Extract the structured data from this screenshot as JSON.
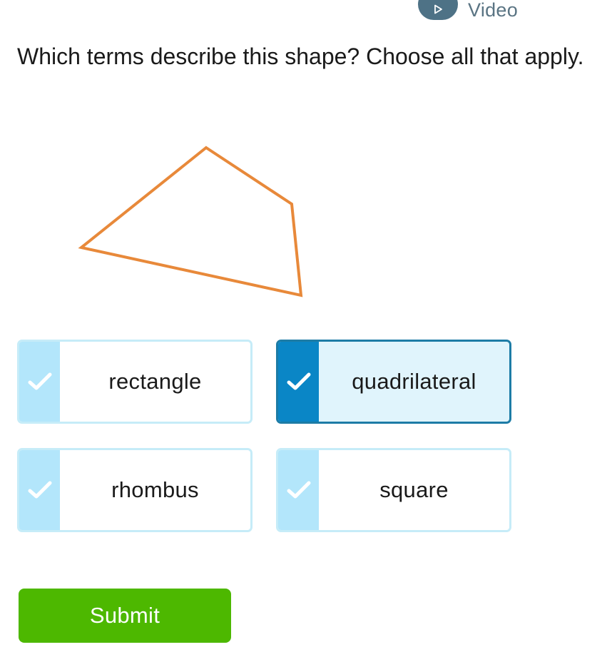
{
  "header": {
    "video_label": "Video"
  },
  "question": {
    "text": "Which terms describe this shape? Choose all that apply."
  },
  "shape": {
    "stroke_color": "#e8893a"
  },
  "options": [
    {
      "label": "rectangle",
      "selected": false
    },
    {
      "label": "quadrilateral",
      "selected": true
    },
    {
      "label": "rhombus",
      "selected": false
    },
    {
      "label": "square",
      "selected": false
    }
  ],
  "submit": {
    "label": "Submit",
    "color": "#4db800"
  },
  "colors": {
    "check_unselected_bg": "#b3e6fb",
    "check_selected_bg": "#0a86c6",
    "option_selected_bg": "#e0f4fc",
    "option_border": "#c6ecf8",
    "option_selected_border": "#1d7ca6"
  },
  "icons": {
    "option_check": "check-icon",
    "video": "play-icon"
  }
}
